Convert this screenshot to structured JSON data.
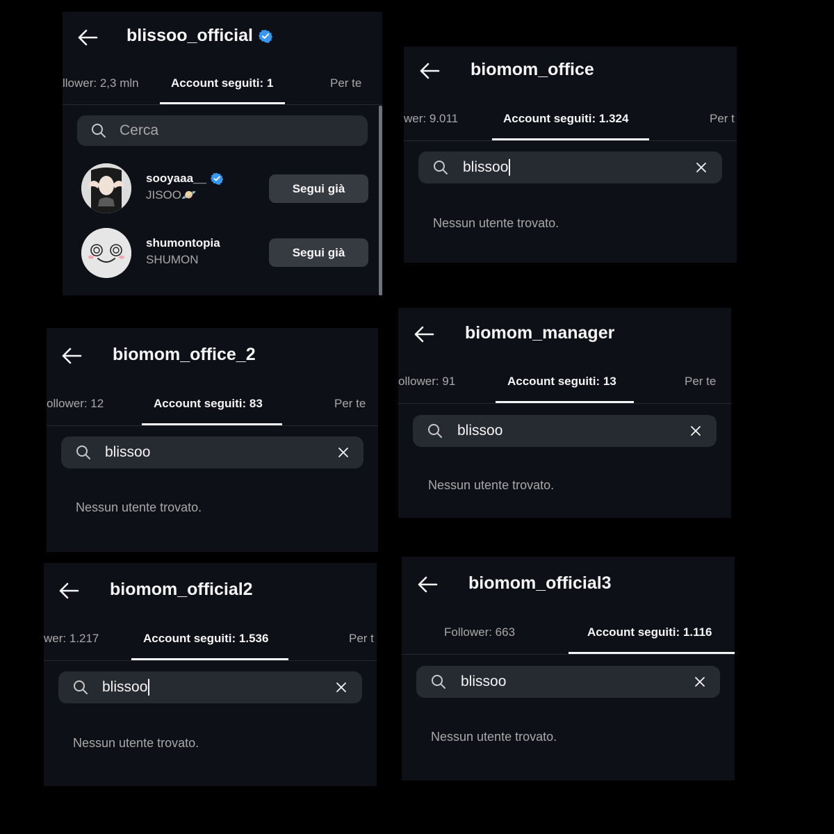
{
  "colors": {
    "background": "#000000",
    "panel": "#0d1117",
    "search_field": "#262a31",
    "button": "#363a41",
    "verified_badge": "#3897f0",
    "muted_text": "#a8a8a8"
  },
  "icons": {
    "back": "arrow-left-icon",
    "search": "search-icon",
    "clear": "close-icon",
    "verified": "verified-badge-icon"
  },
  "panels": [
    {
      "title": "blissoo_official",
      "verified": true,
      "tab_left": "llower: 2,3 mln",
      "tab_active": "Account seguiti: 1",
      "tab_right": "Per te",
      "search_placeholder": "Cerca",
      "users": [
        {
          "username": "sooyaaa__",
          "verified": true,
          "fullname": "JISOO🪐",
          "action": "Segui già"
        },
        {
          "username": "shumontopia",
          "verified": false,
          "fullname": "SHUMON",
          "action": "Segui già"
        }
      ]
    },
    {
      "title": "biomom_office",
      "tab_left": "wer: 9.011",
      "tab_active": "Account seguiti: 1.324",
      "tab_right": "Per t",
      "search_value": "blissoo",
      "empty": "Nessun utente trovato."
    },
    {
      "title": "biomom_office_2",
      "tab_left": "ollower: 12",
      "tab_active": "Account seguiti: 83",
      "tab_right": "Per te",
      "search_value": "blissoo",
      "empty": "Nessun utente trovato."
    },
    {
      "title": "biomom_manager",
      "tab_left": "ollower: 91",
      "tab_active": "Account seguiti: 13",
      "tab_right": "Per te",
      "search_value": "blissoo",
      "empty": "Nessun utente trovato."
    },
    {
      "title": "biomom_official2",
      "tab_left": "wer: 1.217",
      "tab_active": "Account seguiti: 1.536",
      "tab_right": "Per t",
      "search_value": "blissoo",
      "empty": "Nessun utente trovato."
    },
    {
      "title": "biomom_official3",
      "tab_left": "Follower: 663",
      "tab_active": "Account seguiti: 1.116",
      "search_value": "blissoo",
      "empty": "Nessun utente trovato."
    }
  ]
}
